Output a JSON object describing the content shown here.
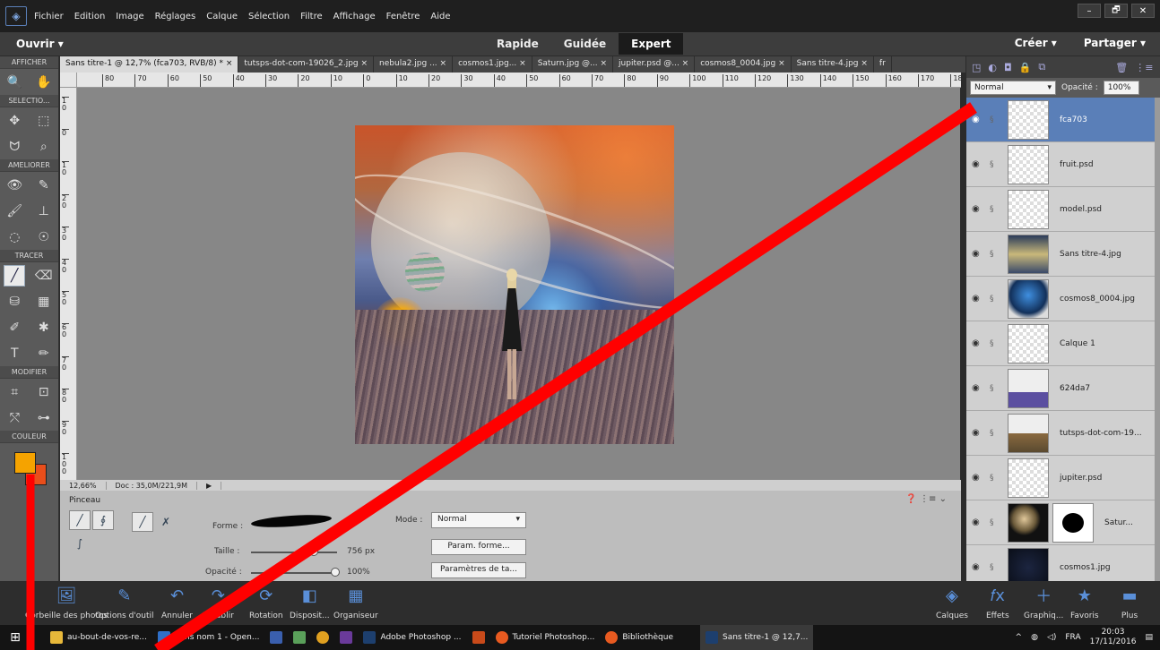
{
  "menubar": {
    "items": [
      "Fichier",
      "Edition",
      "Image",
      "Réglages",
      "Calque",
      "Sélection",
      "Filtre",
      "Affichage",
      "Fenêtre",
      "Aide"
    ],
    "window_controls": [
      "–",
      "🗗",
      "✕"
    ]
  },
  "modebar": {
    "open_label": "Ouvrir ▾",
    "tabs": [
      "Rapide",
      "Guidée",
      "Expert"
    ],
    "create_label": "Créer ▾",
    "share_label": "Partager ▾"
  },
  "toolbox": {
    "sections": [
      "AFFICHER",
      "SELECTIO...",
      "AMELIORER",
      "TRACER",
      "MODIFIER",
      "COULEUR"
    ],
    "foreground_color": "#f5a300",
    "background_color": "#e94e1b"
  },
  "doc_tabs": [
    "Sans titre-1 @ 12,7% (fca703, RVB/8) * ×",
    "tutsps-dot-com-19026_2.jpg ×",
    "nebula2.jpg ... ×",
    "cosmos1.jpg... ×",
    "Saturn.jpg @... ×",
    "jupiter.psd @... ×",
    "cosmos8_0004.jpg ×",
    "Sans titre-4.jpg ×",
    "fr"
  ],
  "ruler": {
    "h_ticks": [
      "80",
      "70",
      "60",
      "50",
      "40",
      "30",
      "20",
      "10",
      "0",
      "10",
      "20",
      "30",
      "40",
      "50",
      "60",
      "70",
      "80",
      "90",
      "100",
      "110",
      "120",
      "130",
      "140",
      "150",
      "160",
      "170",
      "180"
    ],
    "v_ticks": [
      "1 0",
      "0",
      "1 0",
      "2 0",
      "3 0",
      "4 0",
      "5 0",
      "6 0",
      "7 0",
      "8 0",
      "9 0",
      "1 0 0"
    ]
  },
  "status": {
    "zoom": "12,66%",
    "doc": "Doc : 35,0M/221,9M"
  },
  "options": {
    "title": "Pinceau",
    "forme_label": "Forme :",
    "taille_label": "Taille :",
    "taille_value": "756 px",
    "opacite_label": "Opacité :",
    "opacite_value": "100%",
    "mode_label": "Mode :",
    "mode_value": "Normal",
    "param_forme": "Param. forme...",
    "param_tablette": "Paramètres de ta...",
    "help_icons": "❓ ⋮≡ ⌄"
  },
  "layers_panel": {
    "blend_mode": "Normal",
    "opacity_label": "Opacité :",
    "opacity_value": "100%",
    "layers": [
      {
        "name": "fca703",
        "selected": true
      },
      {
        "name": "fruit.psd",
        "selected": false
      },
      {
        "name": "model.psd",
        "selected": false
      },
      {
        "name": "Sans titre-4.jpg",
        "selected": false
      },
      {
        "name": "cosmos8_0004.jpg",
        "selected": false
      },
      {
        "name": "Calque 1",
        "selected": false
      },
      {
        "name": "624da7",
        "selected": false
      },
      {
        "name": "tutsps-dot-com-19...",
        "selected": false
      },
      {
        "name": "jupiter.psd",
        "selected": false
      },
      {
        "name": "Satur...",
        "selected": false
      },
      {
        "name": "cosmos1.jpg",
        "selected": false
      }
    ]
  },
  "bottombar": {
    "left_items": [
      "Corbeille des photos",
      "Options d'outil",
      "Annuler",
      "Rétablir",
      "Rotation",
      "Disposit...",
      "Organiseur"
    ],
    "right_items": [
      "Calques",
      "Effets",
      "Graphiq...",
      "Favoris",
      "Plus"
    ]
  },
  "taskbar": {
    "items": [
      "au-bout-de-vos-re...",
      "Sans nom 1 - Open...",
      "Adobe Photoshop ...",
      "Tutoriel Photoshop...",
      "Bibliothèque",
      "Sans titre-1 @ 12,7..."
    ],
    "lang": "FRA",
    "time": "20:03",
    "date": "17/11/2016"
  }
}
